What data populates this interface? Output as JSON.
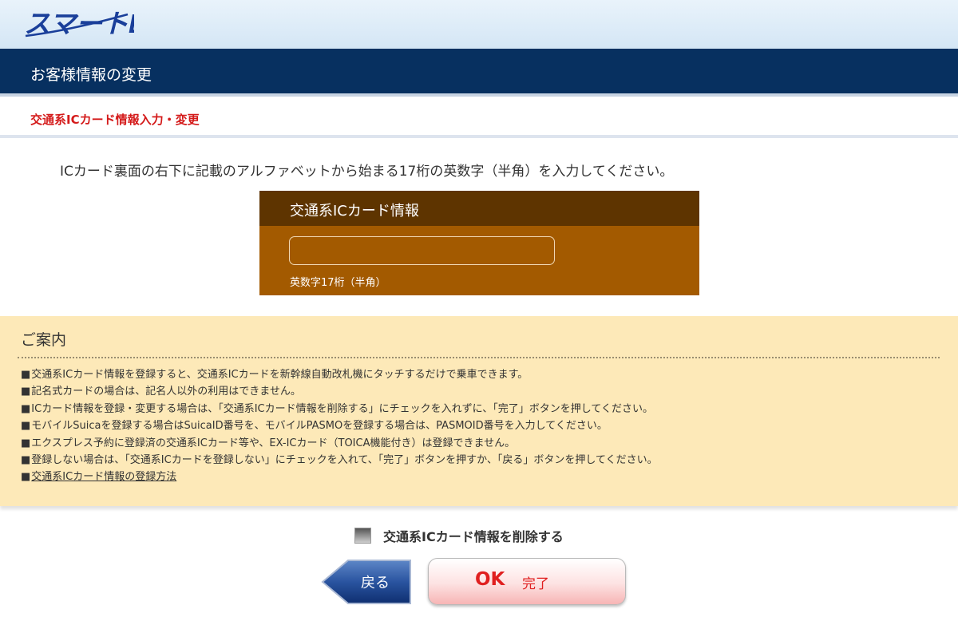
{
  "header": {
    "logo_text": "スマートEX"
  },
  "title_bar": {
    "title": "お客様情報の変更"
  },
  "section": {
    "title": "交通系ICカード情報入力・変更"
  },
  "instruction": "ICカード裏面の右下に記載のアルファベットから始まる17桁の英数字（半角）を入力してください。",
  "card_form": {
    "title": "交通系ICカード情報",
    "input_value": "",
    "hint": "英数字17桁（半角）"
  },
  "notice": {
    "title": "ご案内",
    "items": [
      "交通系ICカード情報を登録すると、交通系ICカードを新幹線自動改札機にタッチするだけで乗車できます。",
      "記名式カードの場合は、記名人以外の利用はできません。",
      "ICカード情報を登録・変更する場合は、「交通系ICカード情報を削除する」にチェックを入れずに、「完了」ボタンを押してください。",
      "モバイルSuicaを登録する場合はSuicaID番号を、モバイルPASMOを登録する場合は、PASMOID番号を入力してください。",
      "エクスプレス予約に登録済の交通系ICカード等や、EX-ICカード（TOICA機能付き）は登録できません。",
      "登録しない場合は、「交通系ICカードを登録しない」にチェックを入れて、「完了」ボタンを押すか、「戻る」ボタンを押してください。"
    ],
    "link": "交通系ICカード情報の登録方法"
  },
  "delete_checkbox": {
    "label": "交通系ICカード情報を削除する",
    "checked": false
  },
  "buttons": {
    "back": "戻る",
    "ok_mark": "OK",
    "ok": "完了"
  },
  "colors": {
    "title_bar": "#073060",
    "section_title": "#d41a1a",
    "card_header": "#5e3400",
    "card_body": "#a35a00",
    "notice_bg": "#fde9b8"
  }
}
